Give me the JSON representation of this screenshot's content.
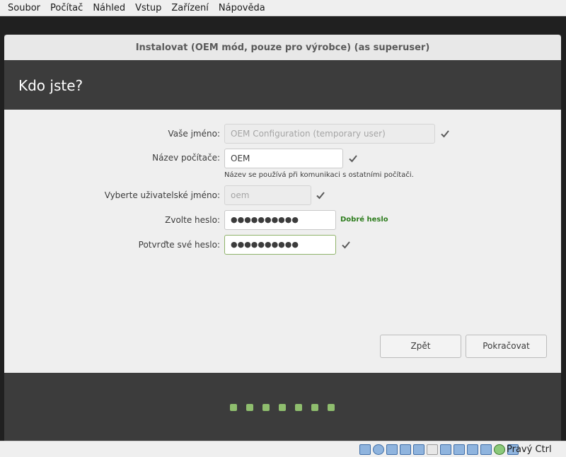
{
  "host_menu": {
    "items": [
      "Soubor",
      "Počítač",
      "Náhled",
      "Vstup",
      "Zařízení",
      "Nápověda"
    ]
  },
  "window": {
    "title": "Instalovat (OEM mód, pouze pro výrobce) (as superuser)"
  },
  "page": {
    "title": "Kdo jste?"
  },
  "form": {
    "your_name": {
      "label": "Vaše jméno:",
      "value": "OEM Configuration (temporary user)"
    },
    "computer_name": {
      "label": "Název počítače:",
      "value": "OEM",
      "hint": "Název se používá při komunikaci s ostatními počítači."
    },
    "username": {
      "label": "Vyberte uživatelské jméno:",
      "value": "oem"
    },
    "password": {
      "label": "Zvolte heslo:",
      "masked": "●●●●●●●●●●",
      "strength": "Dobré heslo"
    },
    "confirm_password": {
      "label": "Potvrďte své heslo:",
      "masked": "●●●●●●●●●●"
    }
  },
  "buttons": {
    "back": "Zpět",
    "continue": "Pokračovat"
  },
  "progress": {
    "total_steps": 7
  },
  "statusbar": {
    "host_key": "Pravý Ctrl",
    "icons": [
      "hard-disk-icon",
      "optical-drive-icon",
      "audio-icon",
      "network-icon",
      "usb-icon",
      "shared-folders-icon",
      "display-icon",
      "video-capture-icon",
      "virtualization-icon",
      "cpu-icon",
      "mouse-integration-icon",
      "keyboard-capture-icon"
    ]
  },
  "colors": {
    "accent_green": "#8fbe6e",
    "strength_green": "#2e7d1e",
    "dark_panel": "#3c3c3c",
    "content_bg": "#efefef"
  }
}
